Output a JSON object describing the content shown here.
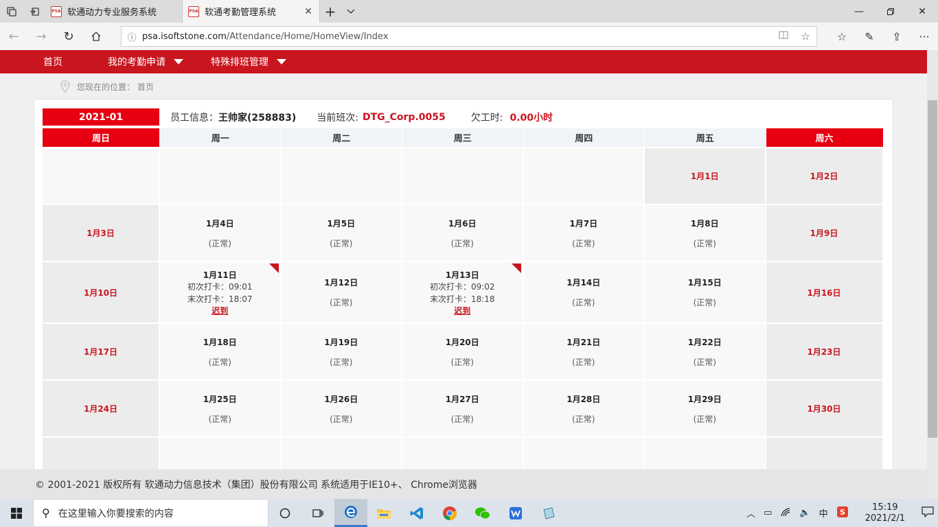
{
  "browser": {
    "tabs": [
      {
        "favicon": "PSA",
        "title": "软通动力专业服务系统"
      },
      {
        "favicon": "PSA",
        "title": "软通考勤管理系统"
      }
    ],
    "url_host": "psa.isoftstone.com",
    "url_path": "/Attendance/Home/HomeView/Index"
  },
  "menu": {
    "items": [
      "首页",
      "我的考勤申请",
      "特殊排班管理"
    ]
  },
  "location": {
    "label": "您现在的位置：",
    "current": "首页"
  },
  "info": {
    "month": "2021-01",
    "employee_label": "员工信息：",
    "employee": "王帅家(258883)",
    "shift_label": "当前班次:",
    "shift": "DTG_Corp.0055",
    "owed_label": "欠工时:",
    "owed": "0.00小时"
  },
  "calendar": {
    "weekdays": [
      "周日",
      "周一",
      "周二",
      "周三",
      "周四",
      "周五",
      "周六"
    ],
    "weeks": [
      [
        {
          "date": ""
        },
        {
          "date": ""
        },
        {
          "date": ""
        },
        {
          "date": ""
        },
        {
          "date": ""
        },
        {
          "date": "1月1日",
          "type": "holiday"
        },
        {
          "date": "1月2日",
          "type": "weekend"
        }
      ],
      [
        {
          "date": "1月3日",
          "type": "weekend"
        },
        {
          "date": "1月4日",
          "status": "(正常)"
        },
        {
          "date": "1月5日",
          "status": "(正常)"
        },
        {
          "date": "1月6日",
          "status": "(正常)"
        },
        {
          "date": "1月7日",
          "status": "(正常)"
        },
        {
          "date": "1月8日",
          "status": "(正常)"
        },
        {
          "date": "1月9日",
          "type": "weekend"
        }
      ],
      [
        {
          "date": "1月10日",
          "type": "weekend"
        },
        {
          "date": "1月11日",
          "first_punch": "初次打卡：09:01",
          "last_punch": "末次打卡：18:07",
          "late": "迟到"
        },
        {
          "date": "1月12日",
          "status": "(正常)"
        },
        {
          "date": "1月13日",
          "first_punch": "初次打卡：09:02",
          "last_punch": "末次打卡：18:18",
          "late": "迟到"
        },
        {
          "date": "1月14日",
          "status": "(正常)"
        },
        {
          "date": "1月15日",
          "status": "(正常)"
        },
        {
          "date": "1月16日",
          "type": "weekend"
        }
      ],
      [
        {
          "date": "1月17日",
          "type": "weekend"
        },
        {
          "date": "1月18日",
          "status": "(正常)"
        },
        {
          "date": "1月19日",
          "status": "(正常)"
        },
        {
          "date": "1月20日",
          "status": "(正常)"
        },
        {
          "date": "1月21日",
          "status": "(正常)"
        },
        {
          "date": "1月22日",
          "status": "(正常)"
        },
        {
          "date": "1月23日",
          "type": "weekend"
        }
      ],
      [
        {
          "date": "1月24日",
          "type": "weekend"
        },
        {
          "date": "1月25日",
          "status": "(正常)"
        },
        {
          "date": "1月26日",
          "status": "(正常)"
        },
        {
          "date": "1月27日",
          "status": "(正常)"
        },
        {
          "date": "1月28日",
          "status": "(正常)"
        },
        {
          "date": "1月29日",
          "status": "(正常)"
        },
        {
          "date": "1月30日",
          "type": "weekend"
        }
      ],
      [
        {
          "date": "",
          "type": "weekend"
        },
        {
          "date": ""
        },
        {
          "date": ""
        },
        {
          "date": ""
        },
        {
          "date": ""
        },
        {
          "date": ""
        },
        {
          "date": "",
          "type": "weekend"
        }
      ]
    ]
  },
  "footer": {
    "text": "© 2001-2021 版权所有 软通动力信息技术（集团）股份有限公司 系统适用于IE10+、 Chrome浏览器"
  },
  "taskbar": {
    "search_placeholder": "在这里输入你要搜索的内容",
    "ime": "中",
    "time": "15:19",
    "date": "2021/2/1"
  },
  "colors": {
    "brand_red": "#c9151e",
    "accent_red": "#e60012"
  }
}
